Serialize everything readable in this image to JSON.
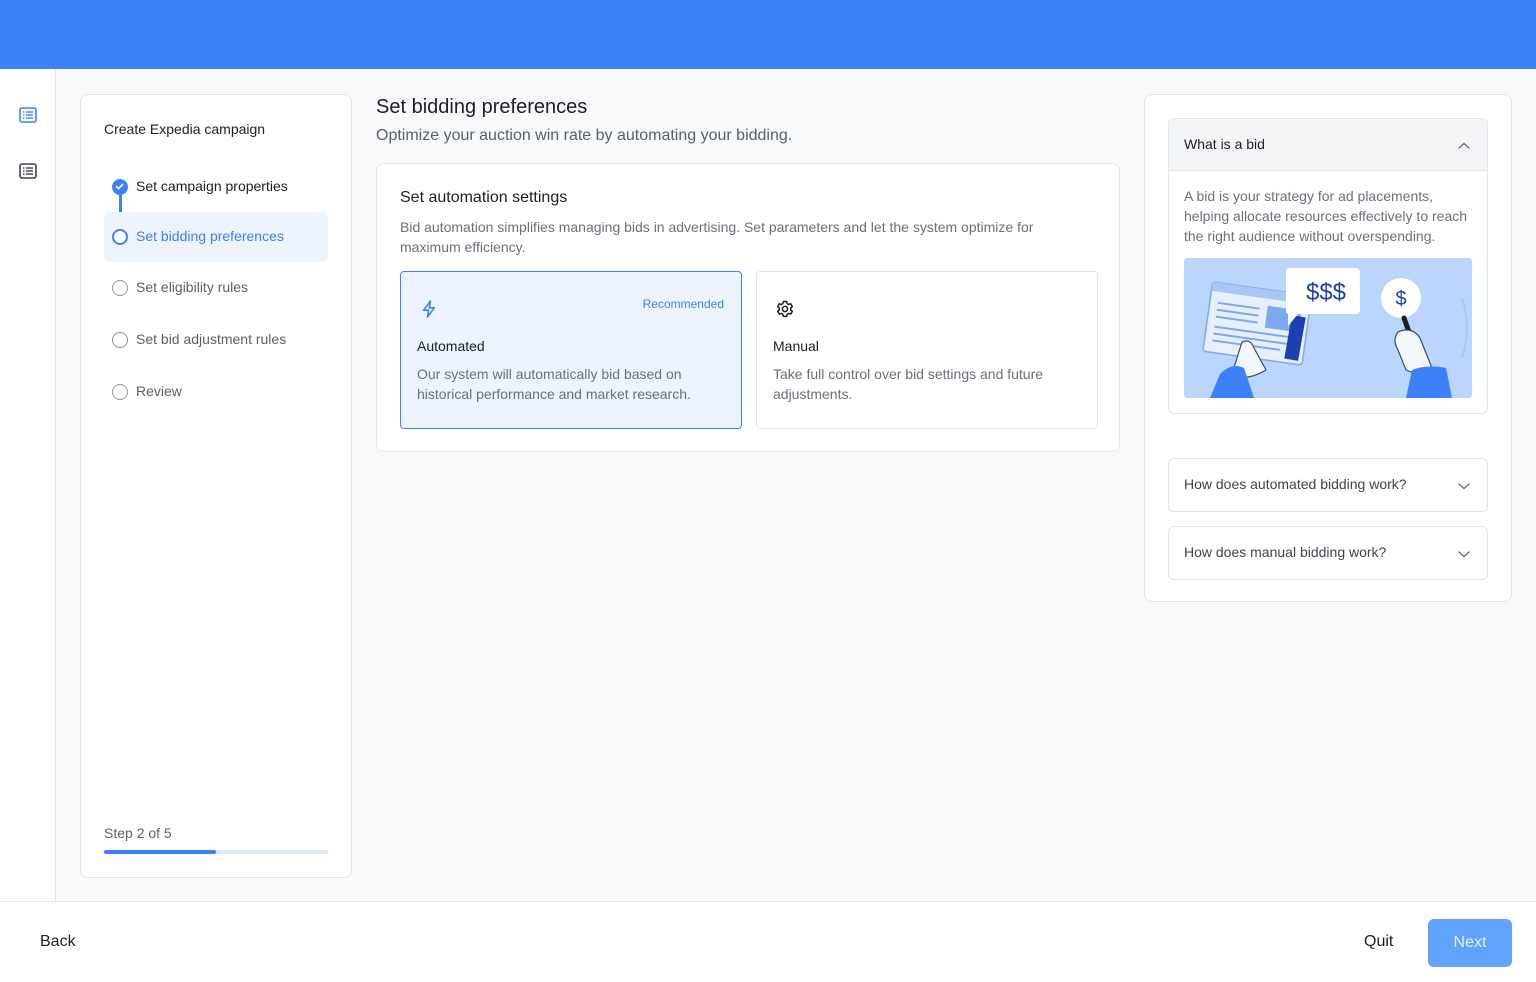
{
  "colors": {
    "brand": "#3b82fa",
    "selected_bg": "#edf4fe",
    "next_button": "#5fa3fc"
  },
  "rail": {
    "icons": [
      "list-icon",
      "list-icon"
    ]
  },
  "steps_panel": {
    "title": "Create Expedia campaign",
    "steps": [
      {
        "label": "Set campaign properties",
        "state": "done"
      },
      {
        "label": "Set bidding preferences",
        "state": "active"
      },
      {
        "label": "Set eligibility rules",
        "state": "pending"
      },
      {
        "label": "Set bid adjustment rules",
        "state": "pending"
      },
      {
        "label": "Review",
        "state": "pending"
      }
    ],
    "step_count": "Step 2 of 5",
    "progress": 0.5
  },
  "main": {
    "title": "Set bidding preferences",
    "subtitle": "Optimize your auction win rate by automating your bidding.",
    "settings": {
      "title": "Set automation settings",
      "description": "Bid automation simplifies managing bids in advertising. Set parameters and let the system optimize for maximum efficiency.",
      "options": [
        {
          "icon": "lightning-icon",
          "badge": "Recommended",
          "title": "Automated",
          "description": "Our system will automatically bid based on historical performance and market research.",
          "selected": true
        },
        {
          "icon": "gear-icon",
          "title": "Manual",
          "description": "Take full control over bid settings and future adjustments.",
          "selected": false
        }
      ]
    }
  },
  "help": {
    "accordions": [
      {
        "title": "What is a bid",
        "open": true,
        "body": "A bid is your strategy for ad placements, helping allocate resources effectively to reach the right audience without overspending.",
        "illustration_text": [
          "$$$",
          "$"
        ]
      },
      {
        "title": "How does automated bidding work?",
        "open": false
      },
      {
        "title": "How does manual bidding work?",
        "open": false
      }
    ]
  },
  "footer": {
    "back": "Back",
    "quit": "Quit",
    "next": "Next"
  }
}
